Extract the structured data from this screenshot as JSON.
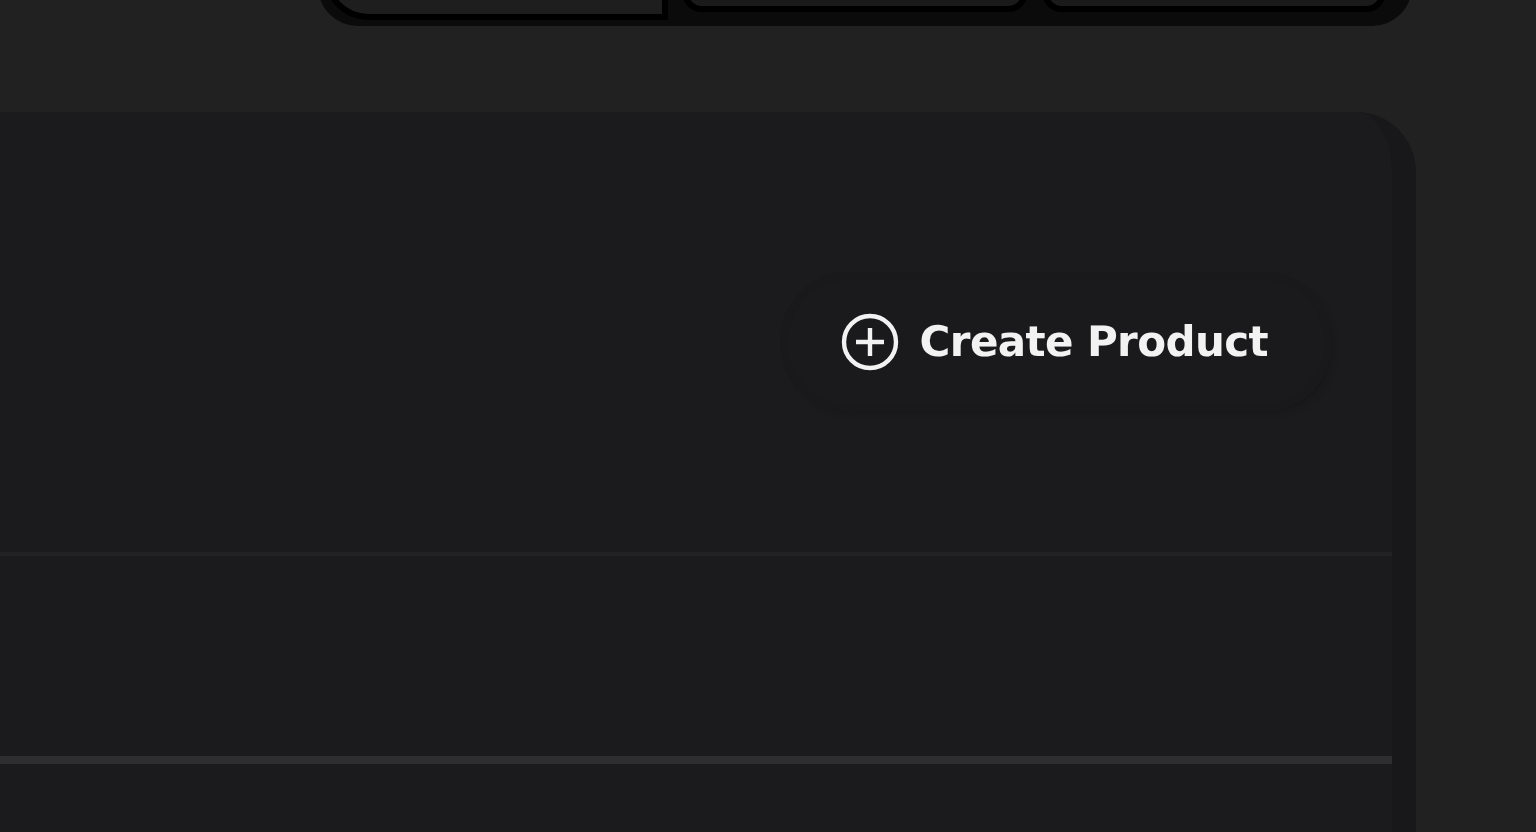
{
  "tabs": [
    {
      "selected": true
    },
    {
      "selected": false
    },
    {
      "selected": false
    }
  ],
  "create_button": {
    "label": "Create Product"
  }
}
